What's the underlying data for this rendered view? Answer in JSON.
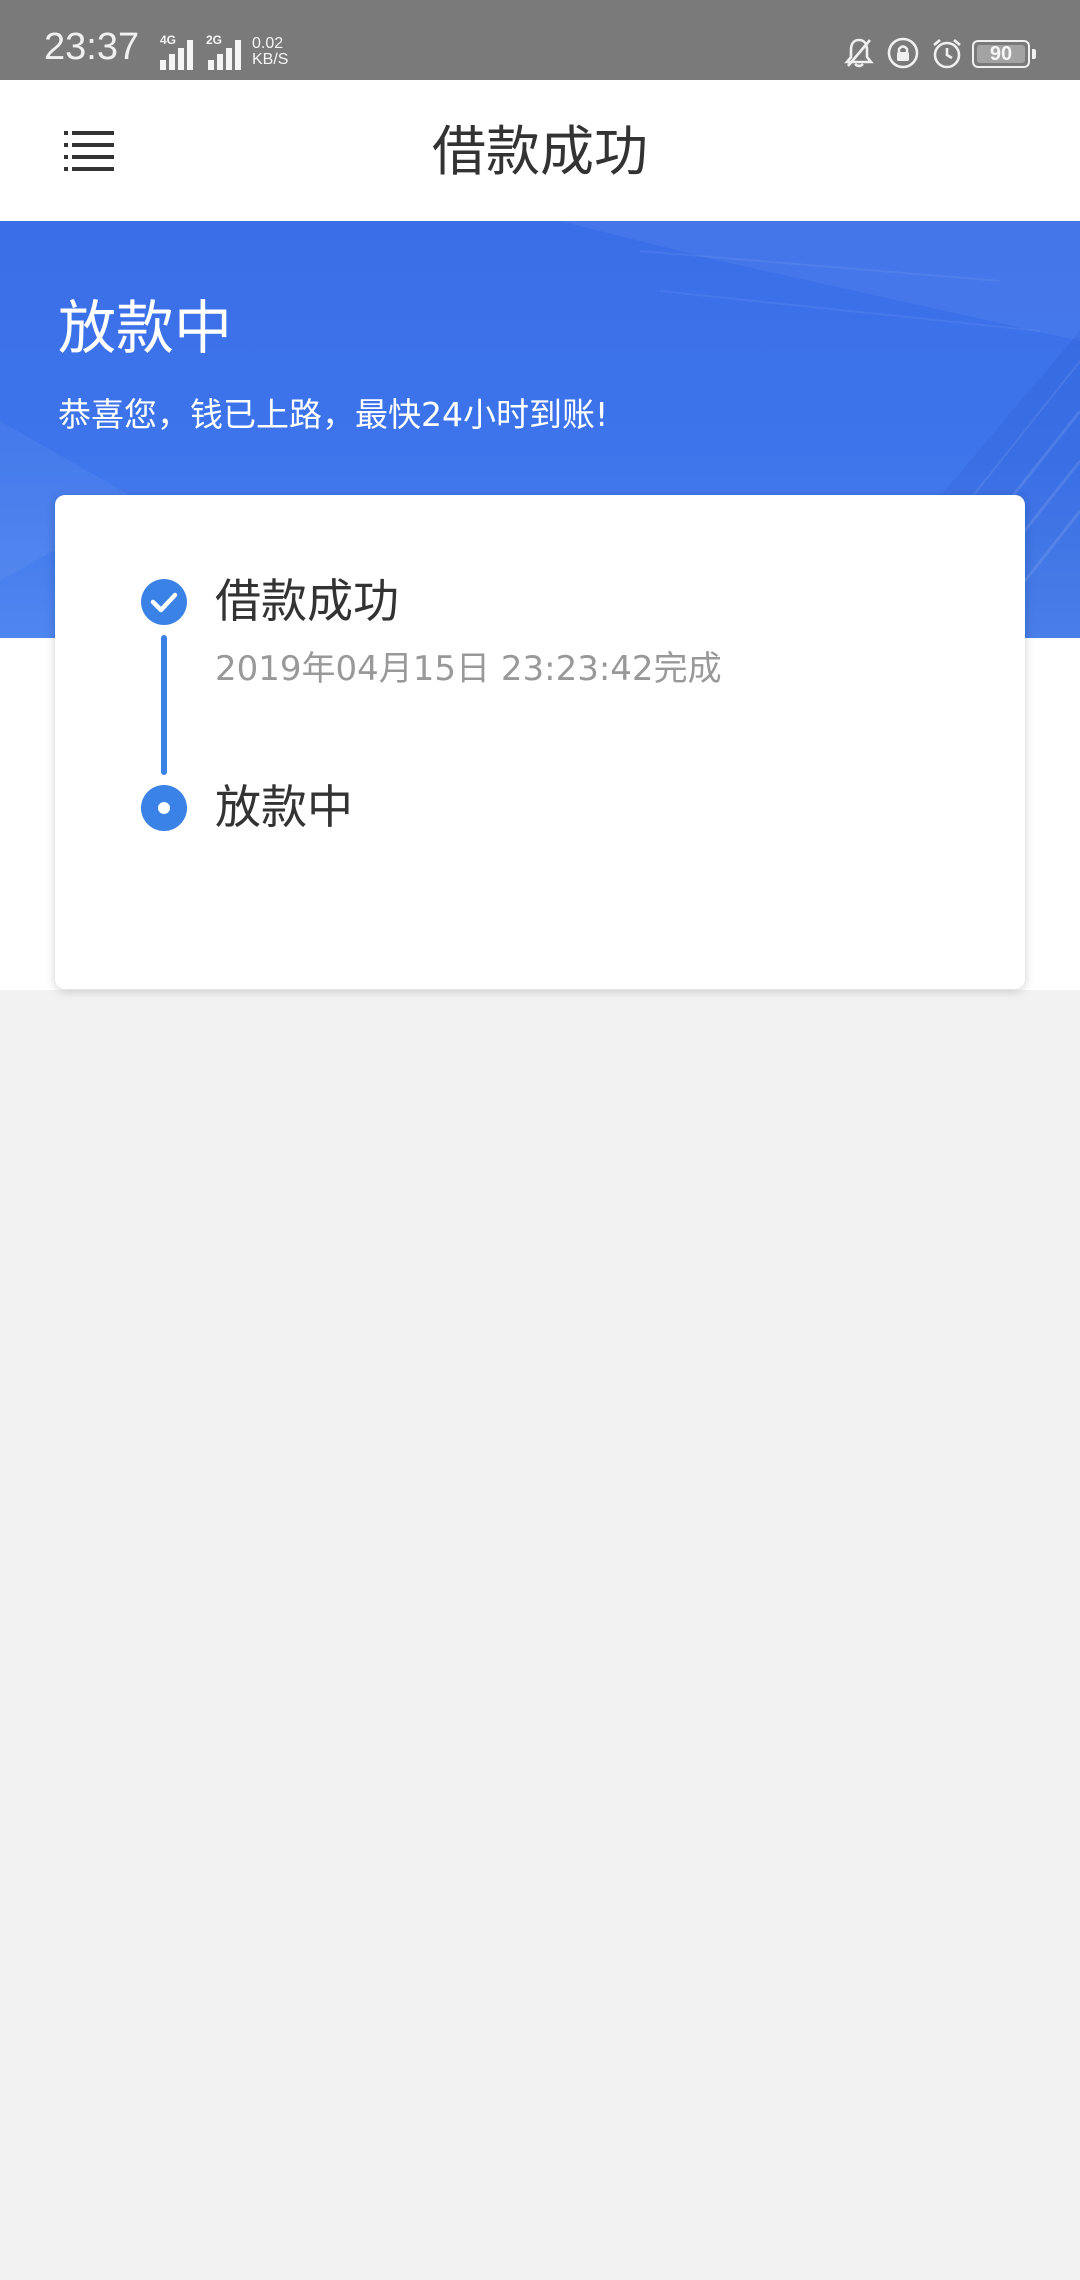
{
  "status_bar": {
    "time": "23:37",
    "signal_1_label": "4G",
    "signal_2_label": "2G",
    "net_speed_value": "0.02",
    "net_speed_unit": "KB/S",
    "battery_level": "90",
    "icons": [
      "bell-off-icon",
      "rotation-lock-icon",
      "alarm-icon",
      "battery-icon"
    ]
  },
  "header": {
    "title": "借款成功",
    "menu_icon": "menu-icon"
  },
  "banner": {
    "title": "放款中",
    "subtitle": "恭喜您，钱已上路，最快24小时到账!"
  },
  "progress": {
    "steps": [
      {
        "title": "借款成功",
        "time": "2019年04月15日 23:23:42完成",
        "state": "done",
        "icon": "check-circle-icon"
      },
      {
        "title": "放款中",
        "state": "current",
        "icon": "dot-circle-icon"
      }
    ]
  },
  "colors": {
    "accent": "#3b82e6",
    "banner": "#3d74eb",
    "status_bar": "#7a7a7a",
    "background": "#f2f2f2"
  }
}
